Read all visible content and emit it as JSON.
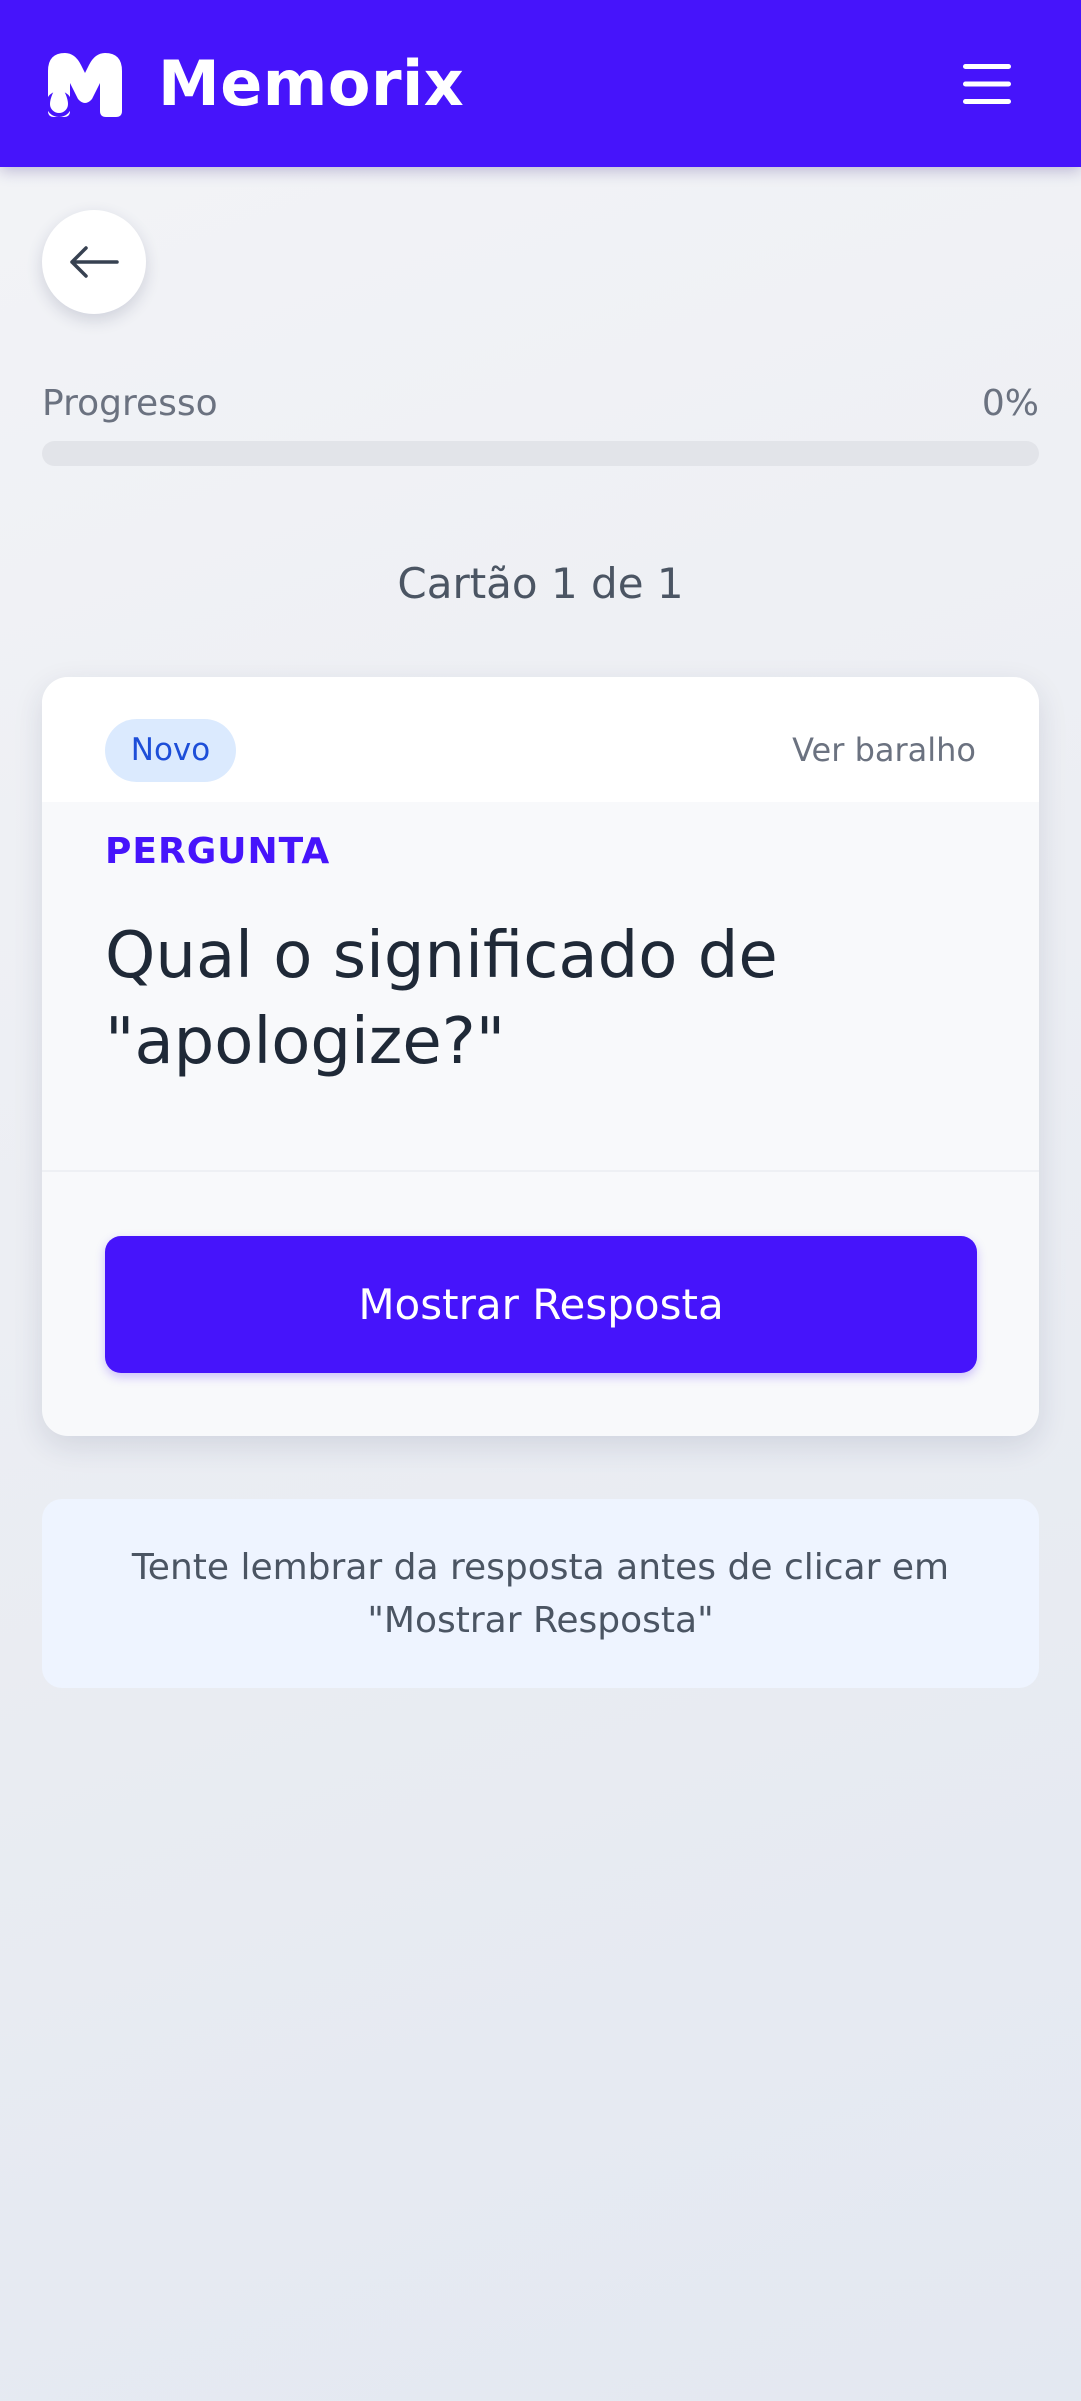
{
  "header": {
    "app_name": "Memorix",
    "logo_icon": "memorix-logo-icon",
    "menu_icon": "hamburger-menu-icon"
  },
  "navigation": {
    "back_icon": "arrow-left-icon"
  },
  "progress": {
    "label": "Progresso",
    "value_text": "0%",
    "fraction": 0
  },
  "card_counter": "Cartão 1 de 1",
  "card": {
    "badge": "Novo",
    "view_deck": "Ver baralho",
    "question_label": "PERGUNTA",
    "question_text": "Qual o significado de \"apologize?\"",
    "show_answer_button": "Mostrar Resposta"
  },
  "hint": "Tente lembrar da resposta antes de clicar em \"Mostrar Resposta\"",
  "colors": {
    "brand": "#4614fb",
    "badge_bg": "#dbeafe",
    "badge_text": "#1d4ed8",
    "hint_bg": "#eef4ff"
  }
}
